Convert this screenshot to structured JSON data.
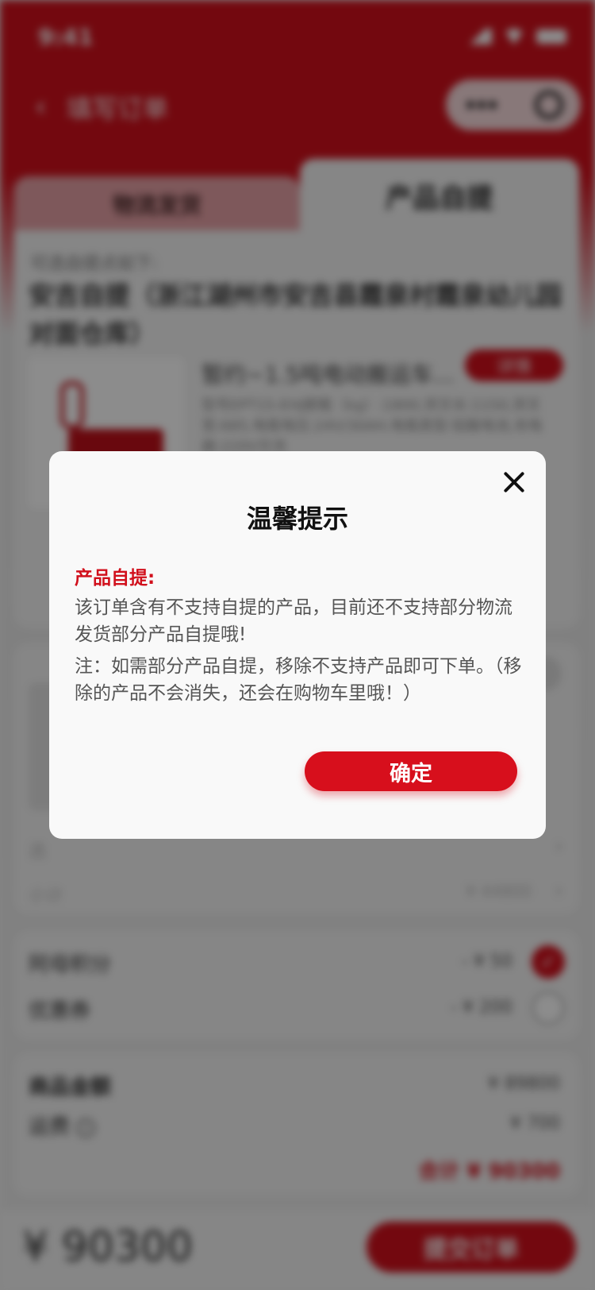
{
  "status_bar": {
    "time": "9:41"
  },
  "nav": {
    "title": "填写订单",
    "back_icon": "‹"
  },
  "tabs": [
    {
      "label": "物流发货",
      "active": false
    },
    {
      "label": "产品自提",
      "active": true
    }
  ],
  "pickup": {
    "hint": "可选自提点如下:",
    "address": "安吉自提（浙江湖州市安吉县霞泉村霞泉幼儿园对面仓库）"
  },
  "product": {
    "name": "暂约~1.5吨电动搬运车...",
    "detail_label": "详情",
    "spec": "型号EPT15-EHJ额载（kg）:1800,货叉长:1150,货叉宽:685,电瓶电压:24V/30AH,电瓶类型:铅酸电池,充电器:220V交流"
  },
  "list_rows": {
    "row_a": "选",
    "row_b": "小计",
    "row_b_value": "¥ 44800"
  },
  "discounts": {
    "points_label": "阿母积分",
    "points_value": "- ¥ 50",
    "coupon_label": "优惠券",
    "coupon_value": "- ¥ 200"
  },
  "summary": {
    "goods_label": "商品金额",
    "goods_value": "¥ 89800",
    "freight_label": "运费",
    "freight_value": "¥ 700",
    "total": "合计 ¥ 90300"
  },
  "bottom": {
    "total": "¥ 90300",
    "submit": "提交订单"
  },
  "modal": {
    "title": "温馨提示",
    "section": "产品自提:",
    "body": "该订单含有不支持自提的产品，目前还不支持部分物流发货部分产品自提哦!",
    "note": "注：如需部分产品自提，移除不支持产品即可下单。（移除的产品不会消失，还会在购物车里哦！）",
    "confirm": "确定"
  },
  "colors": {
    "accent": "#d70f1c"
  }
}
